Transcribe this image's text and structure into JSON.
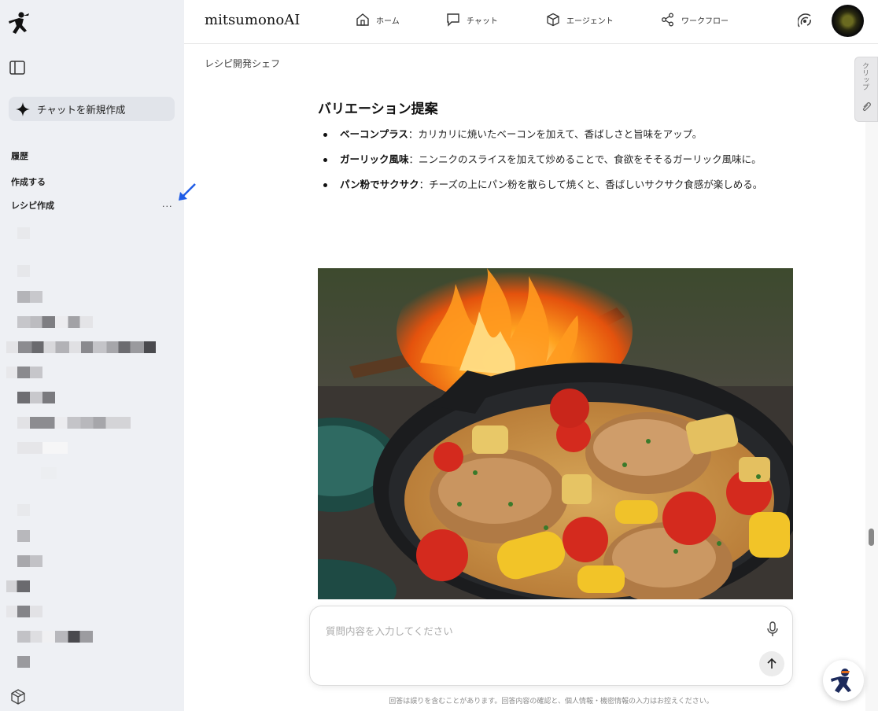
{
  "app": {
    "brand": "mitsumonoAI"
  },
  "nav": [
    {
      "label": "ホーム",
      "icon": "home-icon"
    },
    {
      "label": "チャット",
      "icon": "chat-icon"
    },
    {
      "label": "エージェント",
      "icon": "agent-cube-icon"
    },
    {
      "label": "ワークフロー",
      "icon": "workflow-share-icon"
    }
  ],
  "sidebar": {
    "new_chat_label": "チャットを新規作成",
    "history_heading": "履歴",
    "items": [
      {
        "label": "作成する"
      },
      {
        "label": "レシピ作成",
        "menu": "..."
      }
    ]
  },
  "main": {
    "breadcrumb": "レシピ開発シェフ",
    "section_title": "バリエーション提案",
    "bullets": [
      {
        "term": "ベーコンプラス",
        "text": "：カリカリに焼いたベーコンを加えて、香ばしさと旨味をアップ。"
      },
      {
        "term": "ガーリック風味",
        "text": "：ニンニクのスライスを加えて炒めることで、食欲をそそるガーリック風味に。"
      },
      {
        "term": "パン粉でサクサク",
        "text": "：チーズの上にパン粉を散らして焼くと、香ばしいサクサク食感が楽しめる。"
      }
    ]
  },
  "clip_tab": {
    "label": "クリップ"
  },
  "input": {
    "placeholder": "質問内容を入力してください",
    "disclaimer": "回答は誤りを含むことがあります。回答内容の確認と、個人情報・機密情報の入力はお控えください。"
  },
  "colors": {
    "sidebar_bg": "#eef0f4",
    "annotation_arrow": "#1f5ce6"
  }
}
